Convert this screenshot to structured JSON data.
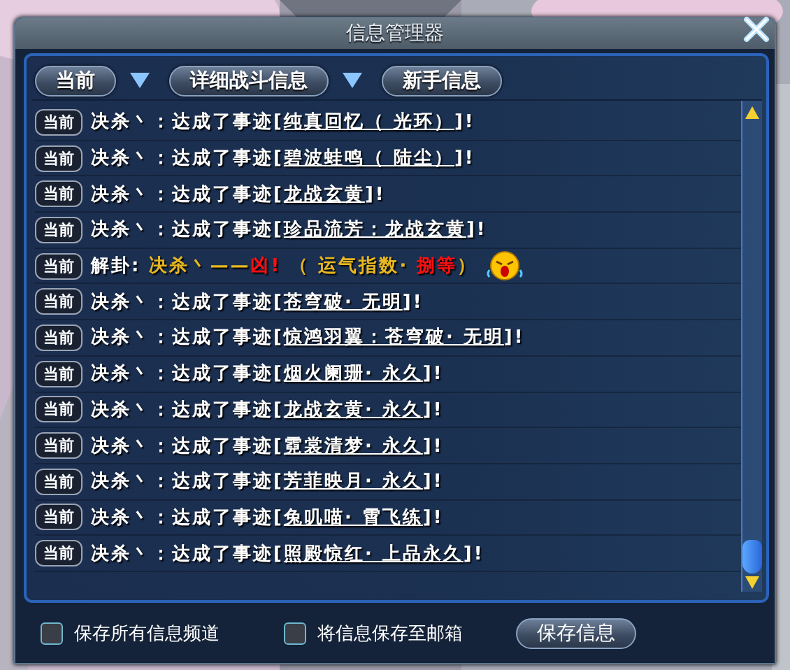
{
  "window": {
    "title": "信息管理器"
  },
  "tabs": [
    {
      "label": "当前",
      "has_dropdown": true
    },
    {
      "label": "详细战斗信息",
      "has_dropdown": true
    },
    {
      "label": "新手信息",
      "has_dropdown": false
    }
  ],
  "messages": [
    {
      "channel": "当前",
      "parts": [
        {
          "kind": "plain",
          "text": "决杀丶：达成了事迹["
        },
        {
          "kind": "link",
          "text": "纯真回忆（ 光环）"
        },
        {
          "kind": "plain",
          "text": "]!"
        }
      ]
    },
    {
      "channel": "当前",
      "parts": [
        {
          "kind": "plain",
          "text": "决杀丶：达成了事迹["
        },
        {
          "kind": "link",
          "text": "碧波蛙鸣（ 陆尘）"
        },
        {
          "kind": "plain",
          "text": "]!"
        }
      ]
    },
    {
      "channel": "当前",
      "parts": [
        {
          "kind": "plain",
          "text": "决杀丶：达成了事迹["
        },
        {
          "kind": "link",
          "text": "龙战玄黄"
        },
        {
          "kind": "plain",
          "text": "]!"
        }
      ]
    },
    {
      "channel": "当前",
      "parts": [
        {
          "kind": "plain",
          "text": "决杀丶：达成了事迹["
        },
        {
          "kind": "link",
          "text": "珍品流芳：龙战玄黄"
        },
        {
          "kind": "plain",
          "text": "]!"
        }
      ]
    },
    {
      "channel": "当前",
      "emote": true,
      "parts": [
        {
          "kind": "plain",
          "text": "解卦: "
        },
        {
          "kind": "gold",
          "text": "决杀丶——"
        },
        {
          "kind": "red",
          "text": "凶!"
        },
        {
          "kind": "gold",
          "text": " （ 运气指数· "
        },
        {
          "kind": "red",
          "text": "捌等"
        },
        {
          "kind": "gold",
          "text": "）"
        }
      ]
    },
    {
      "channel": "当前",
      "parts": [
        {
          "kind": "plain",
          "text": "决杀丶：达成了事迹["
        },
        {
          "kind": "link",
          "text": "苍穹破· 无明"
        },
        {
          "kind": "plain",
          "text": "]!"
        }
      ]
    },
    {
      "channel": "当前",
      "parts": [
        {
          "kind": "plain",
          "text": "决杀丶：达成了事迹["
        },
        {
          "kind": "link",
          "text": "惊鸿羽翼：苍穹破· 无明"
        },
        {
          "kind": "plain",
          "text": "]!"
        }
      ]
    },
    {
      "channel": "当前",
      "parts": [
        {
          "kind": "plain",
          "text": "决杀丶：达成了事迹["
        },
        {
          "kind": "link",
          "text": "烟火阑珊· 永久"
        },
        {
          "kind": "plain",
          "text": "]!"
        }
      ]
    },
    {
      "channel": "当前",
      "parts": [
        {
          "kind": "plain",
          "text": "决杀丶：达成了事迹["
        },
        {
          "kind": "link",
          "text": "龙战玄黄· 永久"
        },
        {
          "kind": "plain",
          "text": "]!"
        }
      ]
    },
    {
      "channel": "当前",
      "parts": [
        {
          "kind": "plain",
          "text": "决杀丶：达成了事迹["
        },
        {
          "kind": "link",
          "text": "霓裳清梦· 永久"
        },
        {
          "kind": "plain",
          "text": "]!"
        }
      ]
    },
    {
      "channel": "当前",
      "parts": [
        {
          "kind": "plain",
          "text": "决杀丶：达成了事迹["
        },
        {
          "kind": "link",
          "text": "芳菲映月· 永久"
        },
        {
          "kind": "plain",
          "text": "]!"
        }
      ]
    },
    {
      "channel": "当前",
      "parts": [
        {
          "kind": "plain",
          "text": "决杀丶：达成了事迹["
        },
        {
          "kind": "link",
          "text": "兔叽喵· 霄飞练"
        },
        {
          "kind": "plain",
          "text": "]!"
        }
      ]
    },
    {
      "channel": "当前",
      "parts": [
        {
          "kind": "plain",
          "text": "决杀丶：达成了事迹["
        },
        {
          "kind": "link",
          "text": "照殿惊红· 上品永久"
        },
        {
          "kind": "plain",
          "text": "]!"
        }
      ]
    }
  ],
  "options": [
    {
      "label": "保存所有信息频道",
      "checked": false
    },
    {
      "label": "将信息保存至邮箱",
      "checked": false
    }
  ],
  "save_button": "保存信息"
}
